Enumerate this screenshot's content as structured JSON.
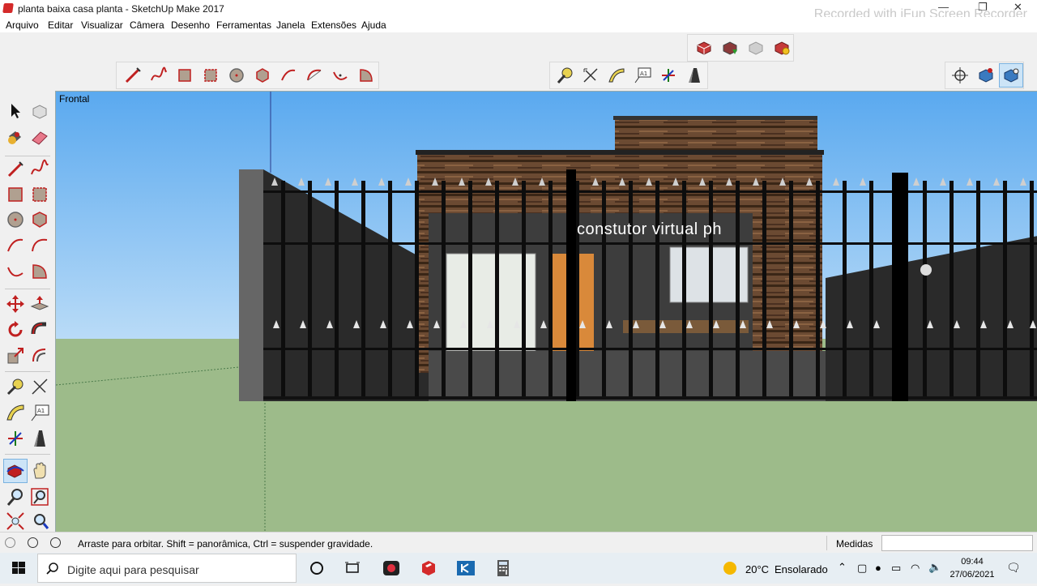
{
  "window": {
    "title": "planta baixa casa planta - SketchUp Make 2017",
    "watermark": "Recorded with iFun Screen Recorder"
  },
  "menu": [
    "Arquivo",
    "Editar",
    "Visualizar",
    "Câmera",
    "Desenho",
    "Ferramentas",
    "Janela",
    "Extensões",
    "Ajuda"
  ],
  "viewport": {
    "scene_label": "Frontal",
    "overlay_text": "constutor virtual ph"
  },
  "status": {
    "hint": "Arraste para orbitar. Shift = panorâmica, Ctrl = suspender gravidade.",
    "measures_label": "Medidas",
    "measures_value": ""
  },
  "taskbar": {
    "search_placeholder": "Digite aqui para pesquisar",
    "weather_temp": "20°C",
    "weather_desc": "Ensolarado",
    "time": "09:44",
    "date": "27/06/2021"
  },
  "colors": {
    "sky": "#6fb6f5",
    "ground": "#9dbb8a",
    "fence": "#0d0d0d",
    "wall": "#2a2a2a",
    "accent_red": "#d42a2a"
  }
}
